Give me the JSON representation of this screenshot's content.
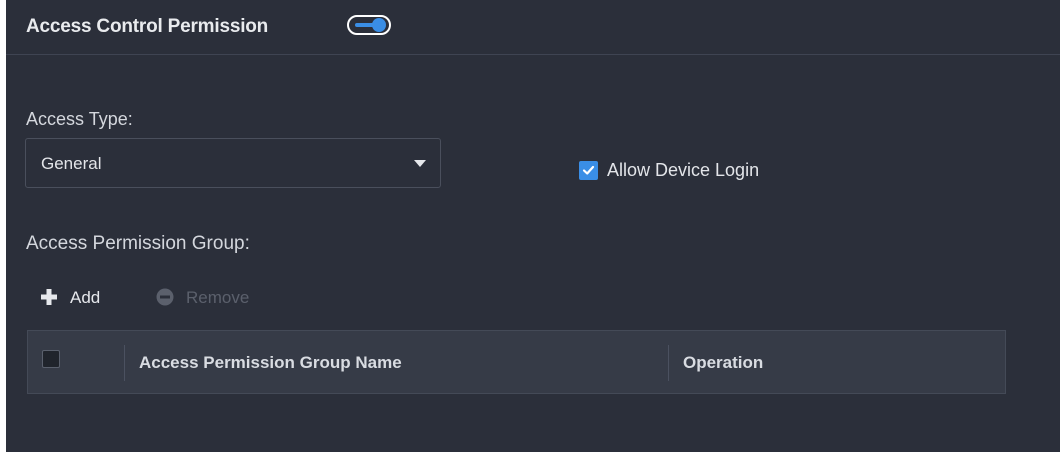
{
  "section": {
    "title": "Access Control Permission",
    "toggle_on": true
  },
  "access_type": {
    "label": "Access Type:",
    "value": "General"
  },
  "allow_device_login": {
    "label": "Allow Device Login",
    "checked": true
  },
  "permission_group": {
    "label": "Access Permission Group:",
    "add_label": "Add",
    "remove_label": "Remove",
    "columns": [
      "Access Permission Group Name",
      "Operation"
    ],
    "rows": []
  },
  "colors": {
    "background": "#2b2f3a",
    "accent": "#3a8ee6",
    "table_header": "#363b47",
    "disabled_text": "#5b606c"
  },
  "icons": {
    "toggle": "toggle-switch-icon",
    "dropdown": "caret-down-icon",
    "checkbox": "checkmark-icon",
    "add": "plus-icon",
    "remove": "minus-circle-icon"
  }
}
